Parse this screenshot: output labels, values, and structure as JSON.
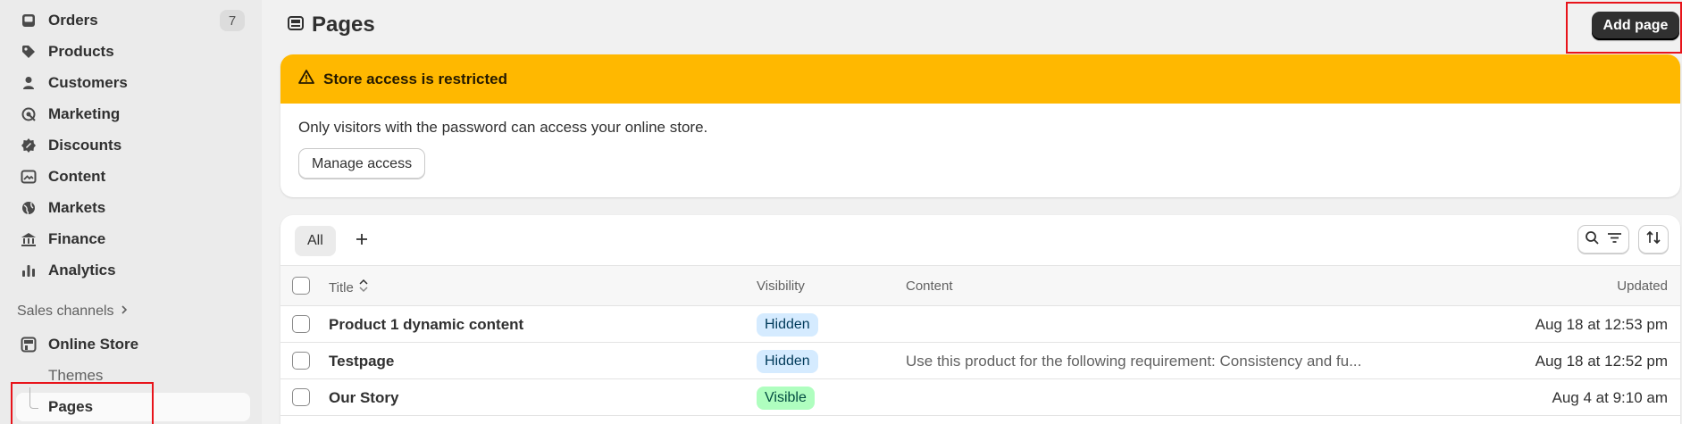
{
  "sidebar": {
    "items": [
      {
        "label": "Orders",
        "icon": "inbox-icon",
        "badge": "7"
      },
      {
        "label": "Products",
        "icon": "tag-icon"
      },
      {
        "label": "Customers",
        "icon": "person-icon"
      },
      {
        "label": "Marketing",
        "icon": "target-icon"
      },
      {
        "label": "Discounts",
        "icon": "discount-icon"
      },
      {
        "label": "Content",
        "icon": "image-icon"
      },
      {
        "label": "Markets",
        "icon": "globe-icon"
      },
      {
        "label": "Finance",
        "icon": "bank-icon"
      },
      {
        "label": "Analytics",
        "icon": "bar-chart-icon"
      }
    ],
    "sales_channels_label": "Sales channels",
    "online_store_label": "Online Store",
    "themes_label": "Themes",
    "pages_label": "Pages"
  },
  "header": {
    "title": "Pages",
    "add_page_label": "Add page"
  },
  "banner": {
    "title": "Store access is restricted",
    "text": "Only visitors with the password can access your online store.",
    "button_label": "Manage access",
    "color": "#ffb800"
  },
  "table": {
    "tab_all": "All",
    "columns": {
      "title": "Title",
      "visibility": "Visibility",
      "content": "Content",
      "updated": "Updated"
    },
    "rows": [
      {
        "title": "Product 1 dynamic content",
        "visibility": "Hidden",
        "content": "",
        "updated": "Aug 18 at 12:53 pm"
      },
      {
        "title": "Testpage",
        "visibility": "Hidden",
        "content": "Use this product for the following requirement: Consistency and fu...",
        "updated": "Aug 18 at 12:52 pm"
      },
      {
        "title": "Our Story",
        "visibility": "Visible",
        "content": "",
        "updated": "Aug 4 at 9:10 am"
      }
    ]
  },
  "colors": {
    "highlight": "#e8141b",
    "hidden_badge": "#d5ebff",
    "visible_badge": "#affebf"
  }
}
